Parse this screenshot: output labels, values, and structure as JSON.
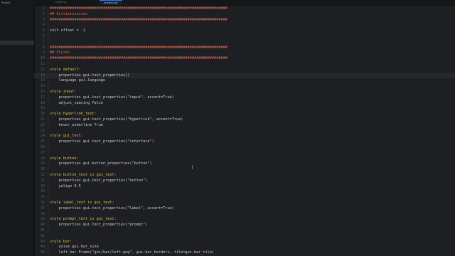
{
  "sidebar": {
    "title": "Project"
  },
  "tabs": [
    {
      "label": "script.rpy",
      "active": false
    },
    {
      "label": "screens.rpy",
      "active": true
    }
  ],
  "colors": {
    "background": "#1e1f22",
    "comment": "#d06a55",
    "keyword": "#e2c04f",
    "text": "#c9ccd1",
    "line_number": "#5a5e66",
    "active_tab_accent": "#3d7bd9"
  },
  "editor": {
    "lines": [
      {
        "n": "1",
        "text": "################################################################################",
        "kind": "comment"
      },
      {
        "n": "2",
        "text": "## Initialization",
        "kind": "comment"
      },
      {
        "n": "3",
        "text": "################################################################################",
        "kind": "comment"
      },
      {
        "n": "4",
        "text": "",
        "kind": "plain"
      },
      {
        "n": "5",
        "text": "init offset = -1",
        "kind": "plain"
      },
      {
        "n": "6",
        "text": "",
        "kind": "plain"
      },
      {
        "n": "7",
        "text": "",
        "kind": "plain"
      },
      {
        "n": "8",
        "text": "################################################################################",
        "kind": "comment"
      },
      {
        "n": "9",
        "text": "## Styles",
        "kind": "comment"
      },
      {
        "n": "10",
        "text": "################################################################################",
        "kind": "comment"
      },
      {
        "n": "11",
        "text": "",
        "kind": "plain"
      },
      {
        "n": "12",
        "text": "style default:",
        "kind": "kw"
      },
      {
        "n": "13",
        "text": "    properties gui.text_properties()",
        "kind": "plain",
        "active": true
      },
      {
        "n": "14",
        "text": "    language gui.language",
        "kind": "plain"
      },
      {
        "n": "15",
        "text": "",
        "kind": "plain"
      },
      {
        "n": "16",
        "text": "style input:",
        "kind": "kw"
      },
      {
        "n": "17",
        "text": "    properties gui.text_properties(\"input\", accent=True)",
        "kind": "plain"
      },
      {
        "n": "18",
        "text": "    adjust_spacing False",
        "kind": "plain"
      },
      {
        "n": "19",
        "text": "",
        "kind": "plain"
      },
      {
        "n": "20",
        "text": "style hyperlink_text:",
        "kind": "kw"
      },
      {
        "n": "21",
        "text": "    properties gui.text_properties(\"hyperlink\", accent=True)",
        "kind": "plain"
      },
      {
        "n": "22",
        "text": "    hover_underline True",
        "kind": "plain"
      },
      {
        "n": "23",
        "text": "",
        "kind": "plain"
      },
      {
        "n": "24",
        "text": "style gui_text:",
        "kind": "kw"
      },
      {
        "n": "25",
        "text": "    properties gui.text_properties(\"interface\")",
        "kind": "plain"
      },
      {
        "n": "26",
        "text": "",
        "kind": "plain"
      },
      {
        "n": "27",
        "text": "",
        "kind": "plain"
      },
      {
        "n": "28",
        "text": "style button:",
        "kind": "kw"
      },
      {
        "n": "29",
        "text": "    properties gui.button_properties(\"button\")",
        "kind": "plain"
      },
      {
        "n": "30",
        "text": "",
        "kind": "plain"
      },
      {
        "n": "31",
        "text": "style button_text is gui_text:",
        "kind": "kw"
      },
      {
        "n": "32",
        "text": "    properties gui.text_properties(\"button\")",
        "kind": "plain"
      },
      {
        "n": "33",
        "text": "    yalign 0.5",
        "kind": "plain"
      },
      {
        "n": "34",
        "text": "",
        "kind": "plain"
      },
      {
        "n": "35",
        "text": "",
        "kind": "plain"
      },
      {
        "n": "36",
        "text": "style label_text is gui_text:",
        "kind": "kw"
      },
      {
        "n": "37",
        "text": "    properties gui.text_properties(\"label\", accent=True)",
        "kind": "plain"
      },
      {
        "n": "38",
        "text": "",
        "kind": "plain"
      },
      {
        "n": "39",
        "text": "style prompt_text is gui_text:",
        "kind": "kw"
      },
      {
        "n": "40",
        "text": "    properties gui.text_properties(\"prompt\")",
        "kind": "plain"
      },
      {
        "n": "41",
        "text": "",
        "kind": "plain"
      },
      {
        "n": "42",
        "text": "",
        "kind": "plain"
      },
      {
        "n": "43",
        "text": "style bar:",
        "kind": "kw"
      },
      {
        "n": "44",
        "text": "    ysize gui.bar_size",
        "kind": "plain"
      },
      {
        "n": "45",
        "text": "    left_bar Frame(\"gui/bar/left.png\", gui.bar_borders, tile=gui.bar_tile)",
        "kind": "plain"
      }
    ]
  }
}
